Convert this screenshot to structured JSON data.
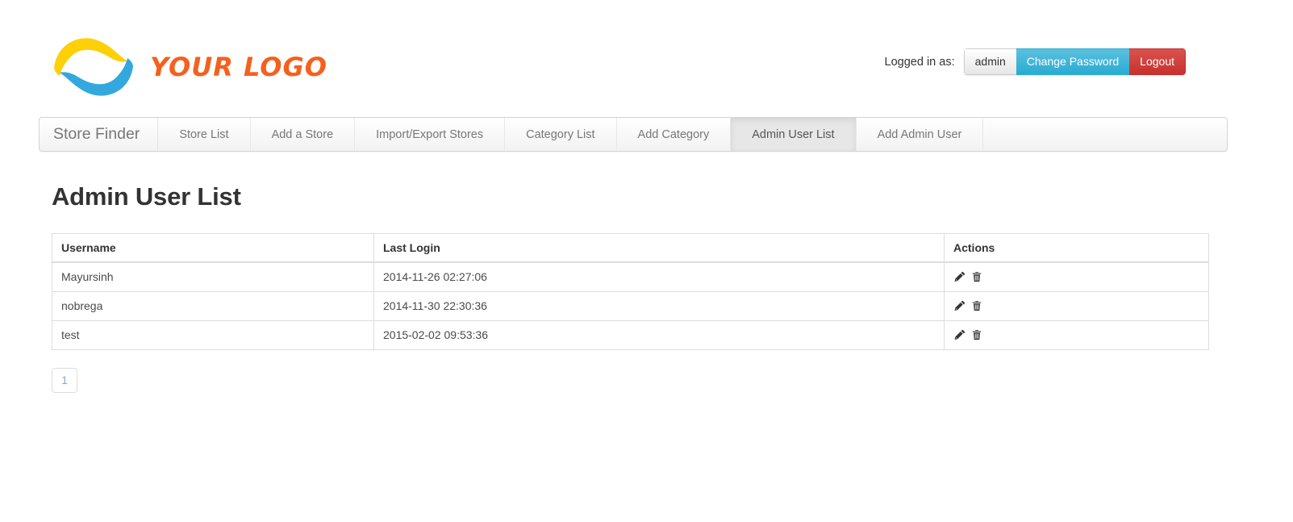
{
  "brand": {
    "logo_text": "YOUR LOGO",
    "logo_icon": "wave-swoosh-logo",
    "colors": {
      "logo_yellow": "#fdd008",
      "logo_blue": "#32a8df",
      "logo_orange": "#f4601e",
      "info_blue": "#5bc0de",
      "danger_red": "#d9534f",
      "active_tab": "#e7e7e7",
      "page_link": "#88a9c7"
    }
  },
  "login_bar": {
    "label": "Logged in as:",
    "username_button": "admin",
    "change_password_button": "Change Password",
    "logout_button": "Logout"
  },
  "navbar": {
    "brand": "Store Finder",
    "items": [
      {
        "label": "Store List",
        "active": false
      },
      {
        "label": "Add a Store",
        "active": false
      },
      {
        "label": "Import/Export Stores",
        "active": false
      },
      {
        "label": "Category List",
        "active": false
      },
      {
        "label": "Add Category",
        "active": false
      },
      {
        "label": "Admin User List",
        "active": true
      },
      {
        "label": "Add Admin User",
        "active": false
      }
    ]
  },
  "main": {
    "page_title": "Admin User List",
    "table": {
      "columns": [
        "Username",
        "Last Login",
        "Actions"
      ],
      "rows": [
        {
          "username": "Mayursinh",
          "last_login": "2014-11-26 02:27:06",
          "actions": [
            "edit-icon",
            "delete-icon"
          ]
        },
        {
          "username": "nobrega",
          "last_login": "2014-11-30 22:30:36",
          "actions": [
            "edit-icon",
            "delete-icon"
          ]
        },
        {
          "username": "test",
          "last_login": "2015-02-02 09:53:36",
          "actions": [
            "edit-icon",
            "delete-icon"
          ]
        }
      ]
    },
    "pagination": {
      "pages": [
        "1"
      ],
      "current": "1"
    }
  }
}
